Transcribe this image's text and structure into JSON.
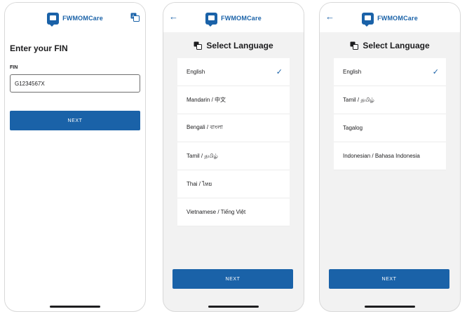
{
  "app": {
    "name": "FWMOMCare",
    "accent": "#1a62a8"
  },
  "screen_fin": {
    "title": "Enter your FIN",
    "fin_label": "FIN",
    "fin_value": "G1234567X",
    "next_label": "NEXT",
    "header_icon": "translate-icon"
  },
  "screen_lang1": {
    "title": "Select Language",
    "back_icon": "back-arrow-icon",
    "languages": [
      {
        "label": "English",
        "selected": true
      },
      {
        "label": "Mandarin / 中文"
      },
      {
        "label": "Bengali / বাংলা"
      },
      {
        "label": "Tamil / தமிழ்"
      },
      {
        "label": "Thai / ไทย"
      },
      {
        "label": "Vietnamese / Tiếng Việt"
      }
    ],
    "check_glyph": "✓",
    "next_label": "NEXT"
  },
  "screen_lang2": {
    "title": "Select Language",
    "back_icon": "back-arrow-icon",
    "languages": [
      {
        "label": "English",
        "selected": true
      },
      {
        "label": "Tamil / தமிழ்"
      },
      {
        "label": "Tagalog"
      },
      {
        "label": "Indonesian / Bahasa Indonesia"
      }
    ],
    "check_glyph": "✓",
    "next_label": "NEXT"
  }
}
